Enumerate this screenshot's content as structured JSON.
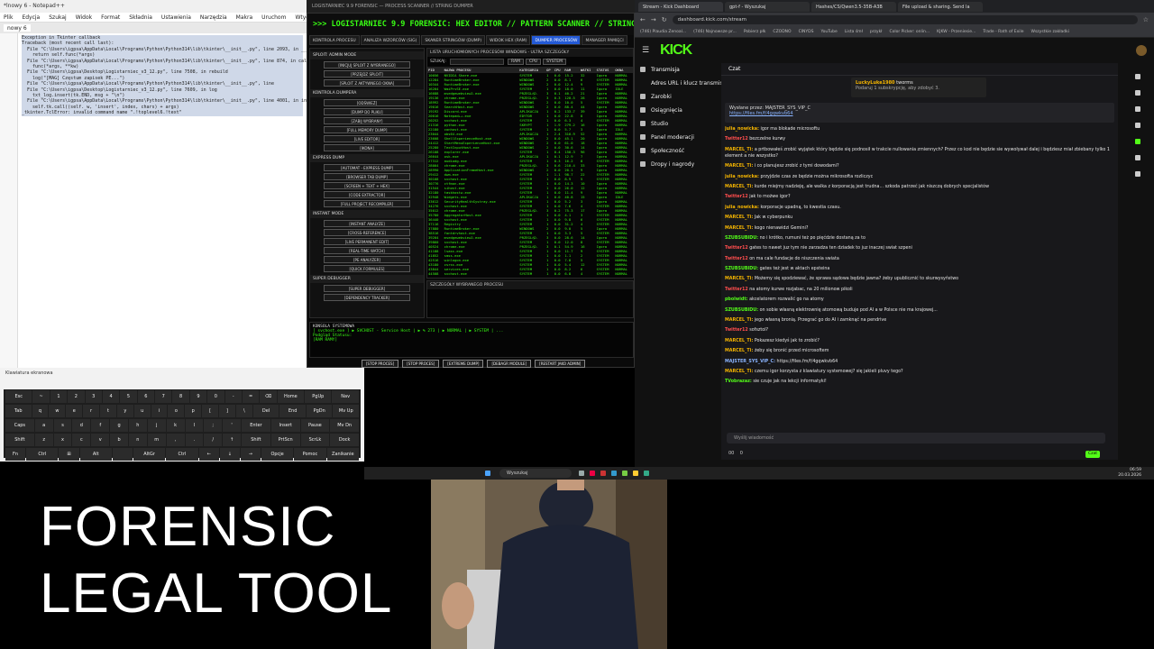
{
  "notepad": {
    "title": "*lnowy 6 - Notepad++",
    "menu": [
      "Plik",
      "Edycja",
      "Szukaj",
      "Widok",
      "Format",
      "Składnia",
      "Ustawienia",
      "Narzędzia",
      "Makra",
      "Uruchom",
      "Wtyczki",
      "Okna",
      "?"
    ],
    "tab": "nowy 6",
    "lines": [
      "Exception in Tkinter callback",
      "Traceback (most recent call last):",
      "  File \"C:\\Users\\igpsa\\AppData\\Local\\Programs\\Python\\Python314\\lib\\tkinter\\__init__.py\", line 2093, in __call__",
      "    return self.func(*args)",
      "  File \"C:\\Users\\igpsa\\AppData\\Local\\Programs\\Python\\Python314\\lib\\tkinter\\__init__.py\", line 874, in callit",
      "    func(*args, **kw)",
      "  File \"C:\\Users\\igpsa\\Desktop\\Logistarniec_v3_12.py\", line 7508, in rebuild",
      "    log(\"[MAG] Częstum zapisek PE...\")",
      "  File \"C:\\Users\\igpsa\\AppData\\Local\\Programs\\Python\\Python314\\lib\\tkinter\\__init__.py\", line",
      "  File \"C:\\Users\\igpsa\\Desktop\\Logistarniec_v3_12.py\", line 7609, in log",
      "    txt_log.insert(tk.END, msg + \"\\n\")",
      "  File \"C:\\Users\\igpsa\\AppData\\Local\\Programs\\Python\\Python314\\lib\\tkinter\\__init__.py\", line 4001, in insert",
      "    self.tk.call((self._w, 'insert', index, chars) + args)",
      "_tkinter.TclError: invalid command name \".!toplevel6.!text\""
    ]
  },
  "forensic": {
    "window_title": "LOGISTARNIEC 9.9 FORENSIC — PROCESS SCANNER // STRING DUMPER",
    "header": ">>> LOGISTARNIEC 9.9 FORENSIC: HEX EDITOR // PATTERN SCANNER // STRING DUMPER //",
    "tabs": [
      "KONTROLA PROCESU",
      "ANALIZA WZORCÓW (SIG)",
      "SKANER STRINGÓW (DUMP)",
      "WIDOK HEX (RAM)",
      "DUMPER PROCESÓW",
      "MANAGER PAMIĘCI"
    ],
    "active_tab": 4,
    "left_sections": [
      {
        "title": "SPLOIT: ADMIN MODE",
        "buttons": [
          "[INICJUJ SPLOIT Z WYBRANEGO]",
          "[PRZEJDZ SPLOIT]",
          "[SPLOIT Z AKTYWNEGO OKNA]"
        ]
      },
      {
        "title": "KONTROLA DUMPERA",
        "buttons": [
          "[ODŚWIEŻ]",
          "[DUMP DO PLIKU]",
          "[ZABIJ WYBRANY]",
          "[FULL MEMORY DUMP]",
          "[LIVE EDITOR]",
          "[IKONA]"
        ]
      },
      {
        "title": "EXPRESS DUMP",
        "buttons": [
          "[AUTOMAT - EXPRESS DUMP]",
          "[BROWSER TAB DUMP]",
          "[SCREEN + TEXT + HEX]",
          "[CODE EXTRACTOR]",
          "[FULL PROJECT RECOMPILER]"
        ]
      },
      {
        "title": "INSTANT MODE",
        "buttons": [
          "[INSTANT ANALYZE]",
          "[CROSS-REFERENCE]",
          "[LIVE PERMANENT EDIT]",
          "[REAL-TIME WATCH]",
          "[PE ANALYZER]",
          "[QUICK FORMULES]"
        ]
      },
      {
        "title": "SUPER DEBUGGER",
        "buttons": [
          "[SUPER DEBUGGER]",
          "[DEPENDENCY TRACKER]"
        ]
      }
    ],
    "process_panel_title": "LISTA URUCHOMIONYCH PROCESÓW WINDOWS - ULTRA SZCZEGÓŁY",
    "filter_label": "SZUKAJ:",
    "filter_buttons": [
      "RAM",
      "CPU",
      "SYSTEM"
    ],
    "columns": [
      "PID",
      "NAZWA PROCESU",
      "KATEGORIA",
      "OP",
      "CPU",
      "RAM",
      "WATKI",
      "STATUS",
      "OKNA"
    ],
    "rows": [
      [
        "10056",
        "NVIDIA Share.exe",
        "SYSTEM",
        "1",
        "0.0",
        "15.2",
        "32",
        "Igora",
        "NORMAL"
      ],
      [
        "12284",
        "RuntimeBroker.exe",
        "WINDOWS",
        "2",
        "0.0",
        "8.1",
        "6",
        "SYSTEM",
        "NORMAL"
      ],
      [
        "10344",
        "RuntimeBroker.exe",
        "WINDOWS",
        "2",
        "0.0",
        "12.4",
        "9",
        "SYSTEM",
        "NORMAL"
      ],
      [
        "16204",
        "WmiPrvSE.exe",
        "SYSTEM",
        "1",
        "0.0",
        "18.0",
        "11",
        "Igora",
        "IDLE"
      ],
      [
        "16688",
        "msedgewebview2.exe",
        "PRZEGLĄD.",
        "3",
        "0.1",
        "40.2",
        "21",
        "Igora",
        "NORMAL"
      ],
      [
        "19136",
        "chrome.exe",
        "PRZEGLĄD.",
        "3",
        "0.3",
        "120.5",
        "28",
        "Igora",
        "NORMAL"
      ],
      [
        "18992",
        "RuntimeBroker.exe",
        "WINDOWS",
        "2",
        "0.0",
        "10.0",
        "5",
        "SYSTEM",
        "NORMAL"
      ],
      [
        "19016",
        "SearchHost.exe",
        "WINDOWS",
        "2",
        "0.0",
        "88.4",
        "44",
        "Igora",
        "NORMAL"
      ],
      [
        "19192",
        "Discord.exe",
        "APLIKACJA",
        "1",
        "0.2",
        "133.7",
        "39",
        "Igora",
        "NORMAL"
      ],
      [
        "20016",
        "Notepad++.exe",
        "EDYTOR",
        "1",
        "0.0",
        "22.8",
        "8",
        "Igora",
        "NORMAL"
      ],
      [
        "20252",
        "svchost.exe",
        "SYSTEM",
        "1",
        "0.0",
        "6.3",
        "4",
        "SYSTEM",
        "NORMAL"
      ],
      [
        "21316",
        "python.exe",
        "SKRYPT",
        "1",
        "1.9",
        "279.2",
        "16",
        "Igora",
        "NORMAL"
      ],
      [
        "22180",
        "conhost.exe",
        "SYSTEM",
        "1",
        "0.0",
        "5.7",
        "3",
        "Igora",
        "IDLE"
      ],
      [
        "23044",
        "obs64.exe",
        "APLIKACJA",
        "1",
        "2.4",
        "310.9",
        "52",
        "Igora",
        "NORMAL"
      ],
      [
        "23608",
        "ShellExperienceHost.exe",
        "WINDOWS",
        "2",
        "0.0",
        "45.1",
        "20",
        "Igora",
        "NORMAL"
      ],
      [
        "24412",
        "StartMenuExperienceHost.exe",
        "WINDOWS",
        "2",
        "0.0",
        "61.0",
        "18",
        "Igora",
        "NORMAL"
      ],
      [
        "25280",
        "TextInputHost.exe",
        "WINDOWS",
        "2",
        "0.0",
        "30.6",
        "14",
        "Igora",
        "NORMAL"
      ],
      [
        "26108",
        "explorer.exe",
        "SYSTEM",
        "1",
        "0.4",
        "150.3",
        "96",
        "Igora",
        "NORMAL"
      ],
      [
        "26644",
        "osk.exe",
        "APLIKACJA",
        "1",
        "0.1",
        "12.9",
        "7",
        "Igora",
        "NORMAL"
      ],
      [
        "27312",
        "audiodg.exe",
        "SYSTEM",
        "1",
        "0.3",
        "16.2",
        "8",
        "SYSTEM",
        "NORMAL"
      ],
      [
        "28004",
        "chrome.exe",
        "PRZEGLĄD.",
        "3",
        "0.6",
        "210.4",
        "33",
        "Igora",
        "NORMAL"
      ],
      [
        "28990",
        "ApplicationFrameHost.exe",
        "WINDOWS",
        "2",
        "0.0",
        "20.1",
        "9",
        "Igora",
        "NORMAL"
      ],
      [
        "29412",
        "dwm.exe",
        "SYSTEM",
        "1",
        "1.1",
        "98.7",
        "22",
        "SYSTEM",
        "NORMAL"
      ],
      [
        "30108",
        "svchost.exe",
        "SYSTEM",
        "1",
        "0.0",
        "8.9",
        "5",
        "SYSTEM",
        "NORMAL"
      ],
      [
        "30776",
        "ctfmon.exe",
        "SYSTEM",
        "1",
        "0.0",
        "14.3",
        "10",
        "Igora",
        "NORMAL"
      ],
      [
        "31544",
        "sihost.exe",
        "SYSTEM",
        "1",
        "0.0",
        "26.0",
        "12",
        "Igora",
        "NORMAL"
      ],
      [
        "32180",
        "taskhostw.exe",
        "SYSTEM",
        "1",
        "0.0",
        "11.4",
        "9",
        "Igora",
        "NORMAL"
      ],
      [
        "32948",
        "Widgets.exe",
        "APLIKACJA",
        "1",
        "0.0",
        "40.8",
        "15",
        "Igora",
        "IDLE"
      ],
      [
        "33612",
        "SecurityHealthSystray.exe",
        "SYSTEM",
        "1",
        "0.0",
        "5.2",
        "3",
        "Igora",
        "NORMAL"
      ],
      [
        "34276",
        "svchost.exe",
        "SYSTEM",
        "1",
        "0.0",
        "7.6",
        "4",
        "SYSTEM",
        "NORMAL"
      ],
      [
        "35012",
        "chrome.exe",
        "PRZEGLĄD.",
        "3",
        "0.2",
        "75.3",
        "17",
        "Igora",
        "NORMAL"
      ],
      [
        "35780",
        "AggregatorHost.exe",
        "SYSTEM",
        "1",
        "0.0",
        "4.1",
        "3",
        "SYSTEM",
        "NORMAL"
      ],
      [
        "36440",
        "svchost.exe",
        "SYSTEM",
        "1",
        "0.0",
        "9.8",
        "6",
        "SYSTEM",
        "NORMAL"
      ],
      [
        "37116",
        "Registry",
        "SYSTEM",
        "1",
        "0.0",
        "31.2",
        "4",
        "SYSTEM",
        "NORMAL"
      ],
      [
        "37880",
        "RuntimeBroker.exe",
        "WINDOWS",
        "2",
        "0.0",
        "9.0",
        "5",
        "Igora",
        "NORMAL"
      ],
      [
        "38516",
        "fontdrvhost.exe",
        "SYSTEM",
        "1",
        "0.0",
        "3.3",
        "5",
        "SYSTEM",
        "NORMAL"
      ],
      [
        "39204",
        "msedgewebview2.exe",
        "PRZEGLĄD.",
        "3",
        "0.0",
        "28.6",
        "14",
        "Igora",
        "NORMAL"
      ],
      [
        "39860",
        "svchost.exe",
        "SYSTEM",
        "1",
        "0.0",
        "12.0",
        "8",
        "SYSTEM",
        "NORMAL"
      ],
      [
        "40524",
        "chrome.exe",
        "PRZEGLĄD.",
        "3",
        "0.1",
        "54.9",
        "16",
        "Igora",
        "NORMAL"
      ],
      [
        "41188",
        "lsass.exe",
        "SYSTEM",
        "1",
        "0.0",
        "11.7",
        "9",
        "SYSTEM",
        "NORMAL"
      ],
      [
        "41852",
        "smss.exe",
        "SYSTEM",
        "1",
        "0.0",
        "1.1",
        "2",
        "SYSTEM",
        "NORMAL"
      ],
      [
        "42516",
        "winlogon.exe",
        "SYSTEM",
        "1",
        "0.0",
        "7.8",
        "5",
        "SYSTEM",
        "NORMAL"
      ],
      [
        "43180",
        "csrss.exe",
        "SYSTEM",
        "1",
        "0.0",
        "5.4",
        "12",
        "SYSTEM",
        "NORMAL"
      ],
      [
        "43844",
        "services.exe",
        "SYSTEM",
        "1",
        "0.0",
        "8.2",
        "6",
        "SYSTEM",
        "NORMAL"
      ],
      [
        "44508",
        "svchost.exe",
        "SYSTEM",
        "1",
        "0.0",
        "6.8",
        "4",
        "SYSTEM",
        "NORMAL"
      ]
    ],
    "lower_panel_title": "SZCZEGÓŁY WYBRANEGO PROCESU",
    "console_title": "KONSOLA SYSTEMOWA",
    "console_lines": [
      "[ svchost.exe ] ▶ SVCHOST - Service Host | ▶ % 273 | ▶ NORMAL | ▶ SYSTEM | ...",
      "Podgląd Statusu:",
      "[RAM RAMY]"
    ],
    "bottom_buttons": [
      "[STOP PROCES]",
      "[STOP PROCES]",
      "[EXTREME DUMP]",
      "[DEBAGR MODULE]",
      "[RESTART JAKO ADMIN]"
    ]
  },
  "browser": {
    "tabs": [
      "Stream - Kick Dashboard",
      "gpt-f - Wyszukaj",
      "Hashes/CS/Qwen3.5-35B-A3B",
      "File upload & sharing. Send la"
    ],
    "url": "dashboard.kick.com/stream",
    "bookmarks": [
      "(746) Plaudia Zenoal...",
      "(746) Najnowsze pr...",
      "Pobierz płk",
      "CZODNO",
      "CINYDS",
      "YouTube",
      "Lista śmł",
      "przykł",
      "Color Picker: onlin...",
      "KJKW - Przeniesie...",
      "Trade - Rath of Exile",
      "Wszystkie zakładki"
    ],
    "logo": "KICK",
    "sidebar": [
      "Transmisja",
      "Adres URL i klucz transmisji",
      "Zarobki",
      "Osiągnięcia",
      "Studio",
      "Panel moderacji",
      "Społeczność",
      "Dropy i nagrody"
    ],
    "chat_title": "Czat",
    "sub_card": {
      "user": "LuckyLuke1980",
      "action": "tworms",
      "text": "Podaruj 1 subskrypcję, aby zdobyć 3."
    },
    "pinned_by": "Wysłane przez: MAJSTER_SYS_VIP_C",
    "pinned_link": "https://files.fm/f/4gqwkvb64",
    "messages": [
      {
        "user": "julia_nowicka:",
        "text": "igor ma blokade microsoftu",
        "color": "#f4b400"
      },
      {
        "user": "Twitter12",
        "text": "bezczelne kurwy",
        "color": "#ff4d4d"
      },
      {
        "user": "MARCEL_Ti:",
        "text": "a prtbowałeś zrobić wyjątek który będzie się podnosił w trakcie nullowania zmiennych? Przez co kod nie będzie sie wywoływał dalej i będziesz miał zbiebany tylko 1 element a nie wszystko?",
        "color": "#f4b400"
      },
      {
        "user": "MARCEL_Ti:",
        "text": "i co planujesz zrobić z tymi dowodami?",
        "color": "#f4b400"
      },
      {
        "user": "julia_nowicka:",
        "text": "przyjdzie czas ze będzie można mikrosofta rozliczyc",
        "color": "#f4b400"
      },
      {
        "user": "MARCEL_Ti:",
        "text": "kurde miejmy nadzieję, ale walka z korporacją jest trudna... szkoda patrzeć jak niszczą dobrych specjalistów",
        "color": "#f4b400"
      },
      {
        "user": "Twitter12",
        "text": "jak to możwe igor?",
        "color": "#ff4d4d"
      },
      {
        "user": "julia_nowicka:",
        "text": "korporacje upadną, to kwestia czasu.",
        "color": "#f4b400"
      },
      {
        "user": "MARCEL_Ti:",
        "text": "Jak w cyberpunku",
        "color": "#f4b400"
      },
      {
        "user": "MARCEL_Ti:",
        "text": "kogo nienawidzi Gemini?",
        "color": "#f4b400"
      },
      {
        "user": "SZUBSUBIDU:",
        "text": "no i krótko, rumuni też po pięćdzie dostaną za to",
        "color": "#53fc18"
      },
      {
        "user": "Twitter12",
        "text": "gates to nawet juz tym nie zarzadza ten dziadek to juz inaczej swiat szpeni",
        "color": "#ff4d4d"
      },
      {
        "user": "Twitter12",
        "text": "on ma cale fundacje do niszczenia swiata",
        "color": "#ff4d4d"
      },
      {
        "user": "SZUBSUBIDU:",
        "text": "gates też jest w aktach epsteina",
        "color": "#53fc18"
      },
      {
        "user": "MARCEL_Ti:",
        "text": "Możemy się spodziewać, że sprawa sądowa będzie jawna? żeby upublicznić to skurwysyństwo",
        "color": "#f4b400"
      },
      {
        "user": "Twitter12",
        "text": "na atomy kurwe rozjabac, na 20 milionow pikoli",
        "color": "#ff4d4d"
      },
      {
        "user": "pbolwidt:",
        "text": "akcelatorem rozwalić go na atomy",
        "color": "#53fc18"
      },
      {
        "user": "SZUBSUBIDU:",
        "text": "on sobie własną elektrownię atomową buduje pod AI a w Polsce nie ma krajowej...",
        "color": "#53fc18"
      },
      {
        "user": "MARCEL_Ti:",
        "text": "jego własną bronią. Przegrać go do AI i zamknąć na pendrive",
        "color": "#f4b400"
      },
      {
        "user": "Twitter12",
        "text": "sofsztol?",
        "color": "#ff4d4d"
      },
      {
        "user": "MARCEL_Ti:",
        "text": "Pokazesz kiedyś jak to zrobić?",
        "color": "#f4b400"
      },
      {
        "user": "MARCEL_Ti:",
        "text": "żeby się bronić przed microsoftem",
        "color": "#f4b400"
      },
      {
        "user": "MAJSTER_SYS_VIP_C:",
        "text": "https://files.fm/f/4gqwkvb64",
        "color": "#8ab4ff"
      },
      {
        "user": "MARCEL_Ti:",
        "text": "czemu igor korzysta z klawiatury systemowej? się jakieli pluvy tego?",
        "color": "#f4b400"
      },
      {
        "user": "TVobrazaz:",
        "text": "sie czuje jak na lekcji informatyki!",
        "color": "#53fc18"
      }
    ],
    "chat_placeholder": "Wyślij wiadomość",
    "chat_button": "Czat",
    "counter_a": "00",
    "counter_b": "0"
  },
  "osk": {
    "title": "Klawiatura ekranowa",
    "rows": [
      [
        "Esc",
        "~",
        "1",
        "2",
        "3",
        "4",
        "5",
        "6",
        "7",
        "8",
        "9",
        "0",
        "-",
        "=",
        "⌫",
        "Home",
        "PgUp",
        "Nav"
      ],
      [
        "Tab",
        "q",
        "w",
        "e",
        "r",
        "t",
        "y",
        "u",
        "i",
        "o",
        "p",
        "[",
        "]",
        "\\",
        "Del",
        "End",
        "PgDn",
        "Mv Up"
      ],
      [
        "Caps",
        "a",
        "s",
        "d",
        "f",
        "g",
        "h",
        "j",
        "k",
        "l",
        ";",
        "'",
        "Enter",
        "Insert",
        "Pause",
        "Mv Dn"
      ],
      [
        "Shift",
        "z",
        "x",
        "c",
        "v",
        "b",
        "n",
        "m",
        ",",
        ".",
        "/",
        "↑",
        "Shift",
        "PrtScn",
        "ScrLk",
        "Dock"
      ],
      [
        "Fn",
        "Ctrl",
        "⊞",
        "Alt",
        "",
        "AltGr",
        "Ctrl",
        "←",
        "↓",
        "→",
        "Opcje",
        "Pomoc",
        "Zanikanie"
      ]
    ]
  },
  "taskbar": {
    "search": "Wyszukaj",
    "time": "06:59",
    "date": "20.03.2026"
  },
  "overlay": {
    "title": "FORENSIC\nLEGAL TOOL"
  }
}
